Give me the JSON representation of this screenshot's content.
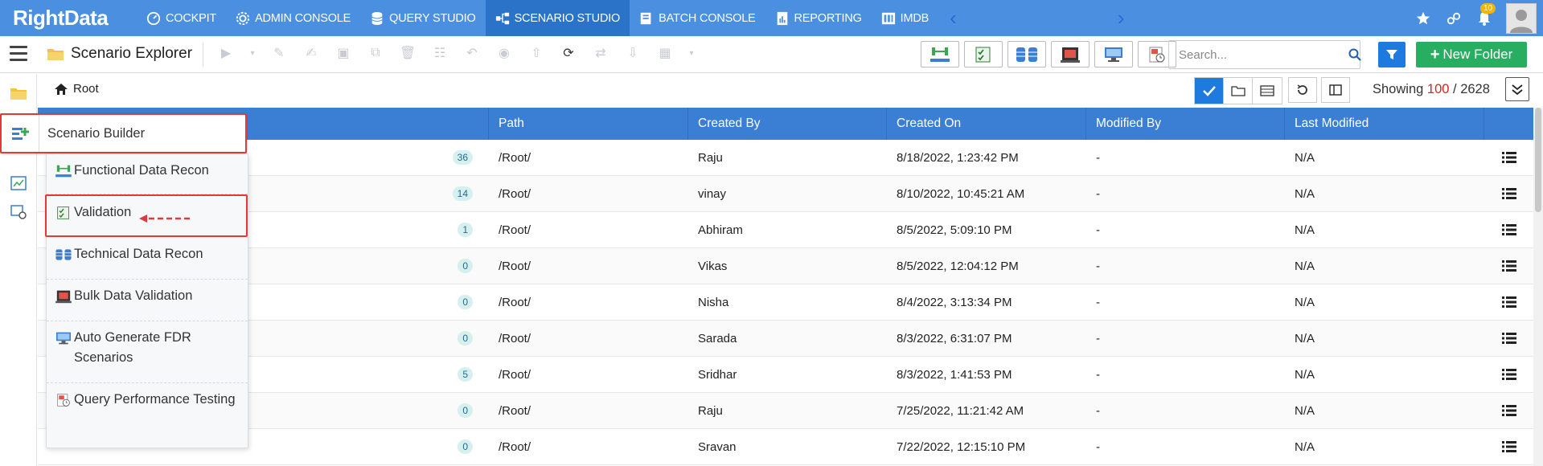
{
  "nav": {
    "logo_text": "RightData",
    "items": [
      {
        "label": "COCKPIT",
        "icon": "speedometer-icon"
      },
      {
        "label": "ADMIN CONSOLE",
        "icon": "gear-icon"
      },
      {
        "label": "QUERY STUDIO",
        "icon": "database-icon"
      },
      {
        "label": "SCENARIO STUDIO",
        "icon": "sitemap-icon",
        "active": true
      },
      {
        "label": "BATCH CONSOLE",
        "icon": "batch-icon"
      },
      {
        "label": "REPORTING",
        "icon": "report-icon"
      },
      {
        "label": "IMDB",
        "icon": "imdb-icon"
      }
    ],
    "notification_count": "10"
  },
  "toolbar": {
    "title": "Scenario Explorer",
    "search_placeholder": "Search...",
    "new_folder_label": "New Folder"
  },
  "breadcrumb": {
    "root_label": "Root",
    "showing_label": "Showing",
    "showing_count": "100",
    "showing_separator": "/",
    "showing_total": "2628"
  },
  "table": {
    "columns": [
      "Path",
      "Created By",
      "Created On",
      "Modified By",
      "Last Modified"
    ],
    "rows": [
      {
        "count": "36",
        "path": "/Root/",
        "created_by": "Raju",
        "created_on": "8/18/2022, 1:23:42 PM",
        "modified_by": "-",
        "last_modified": "N/A"
      },
      {
        "count": "14",
        "path": "/Root/",
        "created_by": "vinay",
        "created_on": "8/10/2022, 10:45:21 AM",
        "modified_by": "-",
        "last_modified": "N/A"
      },
      {
        "count": "1",
        "path": "/Root/",
        "created_by": "Abhiram",
        "created_on": "8/5/2022, 5:09:10 PM",
        "modified_by": "-",
        "last_modified": "N/A"
      },
      {
        "count": "0",
        "path": "/Root/",
        "created_by": "Vikas",
        "created_on": "8/5/2022, 12:04:12 PM",
        "modified_by": "-",
        "last_modified": "N/A"
      },
      {
        "count": "0",
        "path": "/Root/",
        "created_by": "Nisha",
        "created_on": "8/4/2022, 3:13:34 PM",
        "modified_by": "-",
        "last_modified": "N/A"
      },
      {
        "count": "0",
        "path": "/Root/",
        "created_by": "Sarada",
        "created_on": "8/3/2022, 6:31:07 PM",
        "modified_by": "-",
        "last_modified": "N/A"
      },
      {
        "count": "5",
        "path": "/Root/",
        "created_by": "Sridhar",
        "created_on": "8/3/2022, 1:41:53 PM",
        "modified_by": "-",
        "last_modified": "N/A"
      },
      {
        "count": "0",
        "path": "/Root/",
        "created_by": "Raju",
        "created_on": "7/25/2022, 11:21:42 AM",
        "modified_by": "-",
        "last_modified": "N/A"
      },
      {
        "count": "0",
        "path": "/Root/",
        "created_by": "Sravan",
        "created_on": "7/22/2022, 12:15:10 PM",
        "modified_by": "-",
        "last_modified": "N/A"
      }
    ]
  },
  "scenario_builder": {
    "title": "Scenario Builder",
    "items": [
      {
        "label": "Functional Data Recon",
        "icon": "fdr-icon"
      },
      {
        "label": "Validation",
        "icon": "validation-icon",
        "highlighted": true
      },
      {
        "label": "Technical Data Recon",
        "icon": "tdr-icon"
      },
      {
        "label": "Bulk Data Validation",
        "icon": "bulk-validation-icon"
      },
      {
        "label": "Auto Generate FDR Scenarios",
        "icon": "auto-fdr-icon"
      },
      {
        "label": "Query Performance Testing",
        "icon": "query-performance-icon"
      }
    ]
  },
  "colors": {
    "nav_bg": "#4a8fe0",
    "nav_active": "#2a73c9",
    "table_header": "#3b7fd4",
    "primary_button": "#1f7ae0",
    "new_folder_button": "#27ae60",
    "highlight_border": "#e03a3a",
    "showing_count": "#e02020"
  }
}
